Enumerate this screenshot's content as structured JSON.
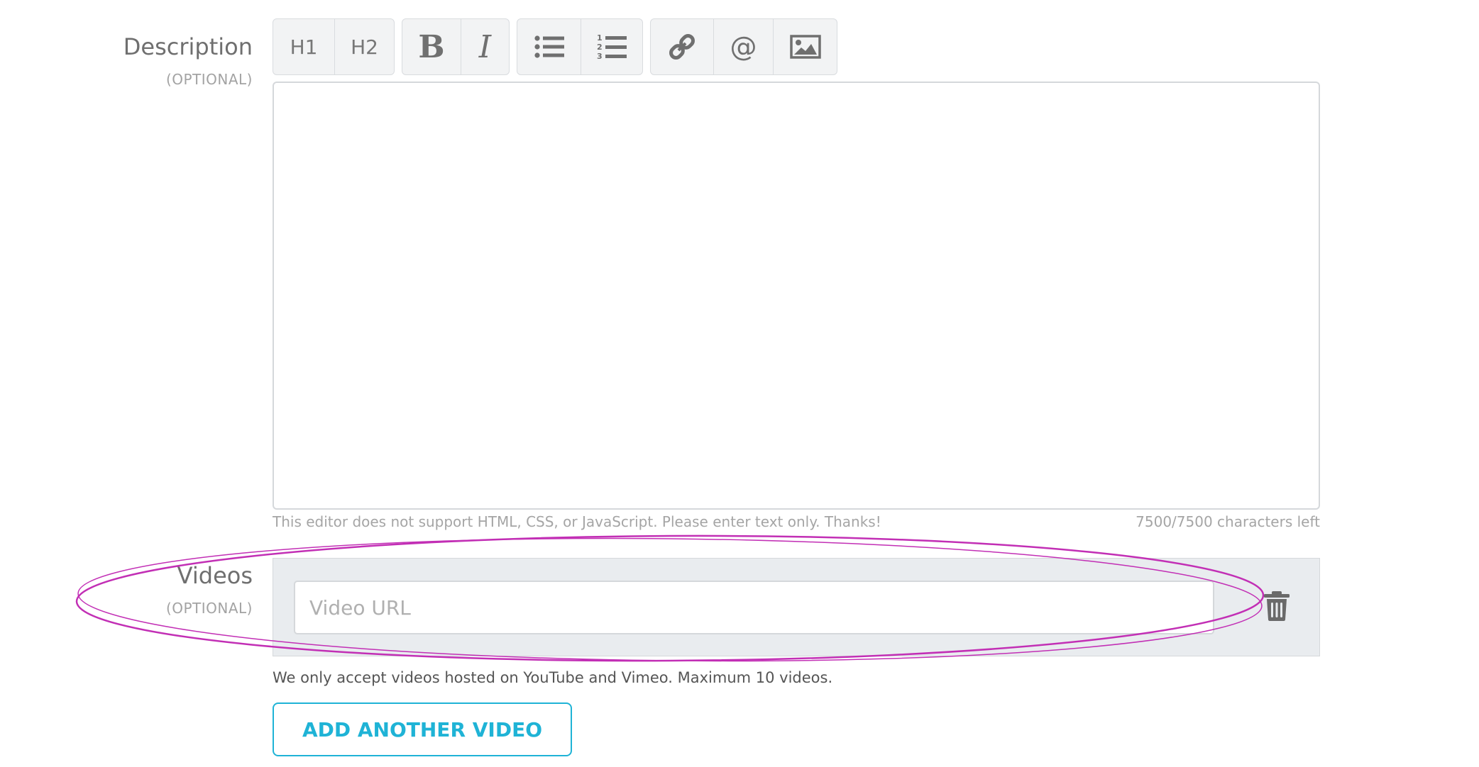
{
  "description": {
    "label": "Description",
    "optional": "(OPTIONAL)",
    "editor_value": "",
    "hint": "This editor does not support HTML, CSS, or JavaScript. Please enter text only. Thanks!",
    "counter": "7500/7500 characters left"
  },
  "toolbar": {
    "h1": "H1",
    "h2": "H2",
    "bold": "B",
    "italic": "I",
    "mention": "@",
    "icons": [
      "bullet-list-icon",
      "numbered-list-icon",
      "link-icon",
      "image-icon"
    ]
  },
  "videos": {
    "label": "Videos",
    "optional": "(OPTIONAL)",
    "input_value": "",
    "input_placeholder": "Video URL",
    "note": "We only accept videos hosted on YouTube and Vimeo. Maximum 10 videos.",
    "add_button": "ADD ANOTHER VIDEO",
    "delete_icon": "trash-icon"
  },
  "colors": {
    "accent": "#1fb3d6",
    "annotation": "#c22fb5",
    "panel_bg": "#e9ecef"
  }
}
